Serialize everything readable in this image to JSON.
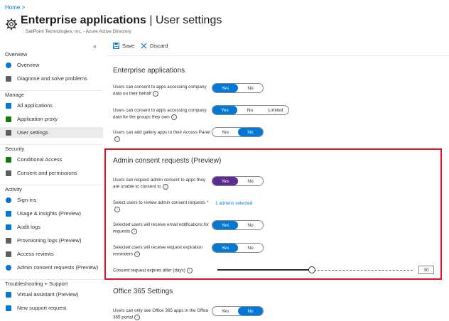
{
  "header": {
    "breadcrumb": "Home >",
    "title_bold": "Enterprise applications",
    "title_rest": " | User settings",
    "subtitle": "SailPoint Technologies, Inc. - Azure Active Directory"
  },
  "sidebar": {
    "collapse": "«",
    "sections": [
      {
        "label": "Overview",
        "items": [
          {
            "label": "Overview",
            "icon": "info-icon",
            "color": "#0078d4"
          },
          {
            "label": "Diagnose and solve problems",
            "icon": "wrench-icon",
            "color": "#605e5c"
          }
        ]
      },
      {
        "label": "Manage",
        "items": [
          {
            "label": "All applications",
            "icon": "grid-icon",
            "color": "#0078d4"
          },
          {
            "label": "Application proxy",
            "icon": "proxy-icon",
            "color": "#107c10"
          },
          {
            "label": "User settings",
            "icon": "gear-icon",
            "color": "#605e5c",
            "selected": true
          }
        ]
      },
      {
        "label": "Security",
        "items": [
          {
            "label": "Conditional Access",
            "icon": "conditional-access-icon",
            "color": "#107c10"
          },
          {
            "label": "Consent and permissions",
            "icon": "gear-icon",
            "color": "#605e5c"
          }
        ]
      },
      {
        "label": "Activity",
        "items": [
          {
            "label": "Sign-ins",
            "icon": "sign-in-icon",
            "color": "#0078d4"
          },
          {
            "label": "Usage & insights (Preview)",
            "icon": "chart-icon",
            "color": "#0078d4"
          },
          {
            "label": "Audit logs",
            "icon": "log-icon",
            "color": "#0078d4"
          },
          {
            "label": "Provisioning logs (Preview)",
            "icon": "person-icon",
            "color": "#605e5c"
          },
          {
            "label": "Access reviews",
            "icon": "list-icon",
            "color": "#605e5c"
          },
          {
            "label": "Admin consent requests (Preview)",
            "icon": "circle-icon",
            "color": "#0078d4"
          }
        ]
      },
      {
        "label": "Troubleshooting + Support",
        "items": [
          {
            "label": "Virtual assistant (Preview)",
            "icon": "assistant-icon",
            "color": "#0078d4"
          },
          {
            "label": "New support request",
            "icon": "support-icon",
            "color": "#0078d4"
          }
        ]
      }
    ]
  },
  "toolbar": {
    "save": "Save",
    "discard": "Discard"
  },
  "enterprise": {
    "title": "Enterprise applications",
    "settings": [
      {
        "label": "Users can consent to apps accessing company data on their behalf",
        "options": [
          "Yes",
          "No"
        ],
        "selected": 0
      },
      {
        "label": "Users can consent to apps accessing company data for the groups they own",
        "options": [
          "Yes",
          "No",
          "Limited"
        ],
        "selected": 0
      },
      {
        "label": "Users can add gallery apps to their Access Panel",
        "options": [
          "Yes",
          "No"
        ],
        "selected": 1
      }
    ]
  },
  "admin": {
    "title": "Admin consent requests (Preview)",
    "request_label": "Users can request admin consent to apps they are unable to consent to",
    "request_options": [
      "Yes",
      "No"
    ],
    "reviewers_label": "Select users to review admin consent requests *",
    "reviewers_link": "1 admins selected",
    "email_label": "Selected users will receive email notifications for requests",
    "email_options": [
      "Yes",
      "No"
    ],
    "reminder_label": "Selected users will receive request expiration reminders",
    "reminder_options": [
      "Yes",
      "No"
    ],
    "expire_label": "Consent request expires after (days)",
    "expire_value": "30",
    "expire_fraction": 0.48
  },
  "office": {
    "title": "Office 365 Settings",
    "label": "Users can only see Office 365 apps in the Office 365 portal",
    "options": [
      "Yes",
      "No"
    ],
    "selected": 1
  },
  "colors": {
    "accent": "#0078d4",
    "purple": "#5c2d91",
    "highlight": "#e81123"
  }
}
